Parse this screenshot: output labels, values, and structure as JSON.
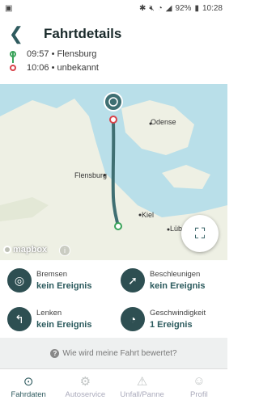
{
  "status_bar": {
    "battery": "92%",
    "time": "10:28"
  },
  "header": {
    "title": "Fahrtdetails",
    "back_icon": "chevron-left-icon"
  },
  "timeline": {
    "start": {
      "time_text": "09:57 • Flensburg"
    },
    "end": {
      "time_text": "10:06 • unbekannt"
    }
  },
  "map": {
    "labels": [
      "Odense",
      "Flensburg",
      "Kiel",
      "Lübeck"
    ],
    "attribution": "mapbox",
    "colors": {
      "route": "#3f6f72",
      "start": "#3aa35a",
      "end": "#d9434a"
    }
  },
  "events": [
    {
      "label": "Bremsen",
      "value": "kein Ereignis",
      "icon": "brake-icon"
    },
    {
      "label": "Beschleunigen",
      "value": "kein Ereignis",
      "icon": "rocket-icon"
    },
    {
      "label": "Lenken",
      "value": "kein Ereignis",
      "icon": "turn-arrow-icon"
    },
    {
      "label": "Geschwindigkeit",
      "value": "1 Ereignis",
      "icon": "speedometer-icon"
    }
  ],
  "rating": {
    "text": "Wie wird meine Fahrt bewertet?"
  },
  "nav": [
    {
      "label": "Fahrdaten",
      "icon": "steering-wheel-icon",
      "active": true
    },
    {
      "label": "Autoservice",
      "icon": "car-service-icon",
      "active": false
    },
    {
      "label": "Unfall/Panne",
      "icon": "accident-icon",
      "active": false
    },
    {
      "label": "Profil",
      "icon": "profile-icon",
      "active": false
    }
  ]
}
